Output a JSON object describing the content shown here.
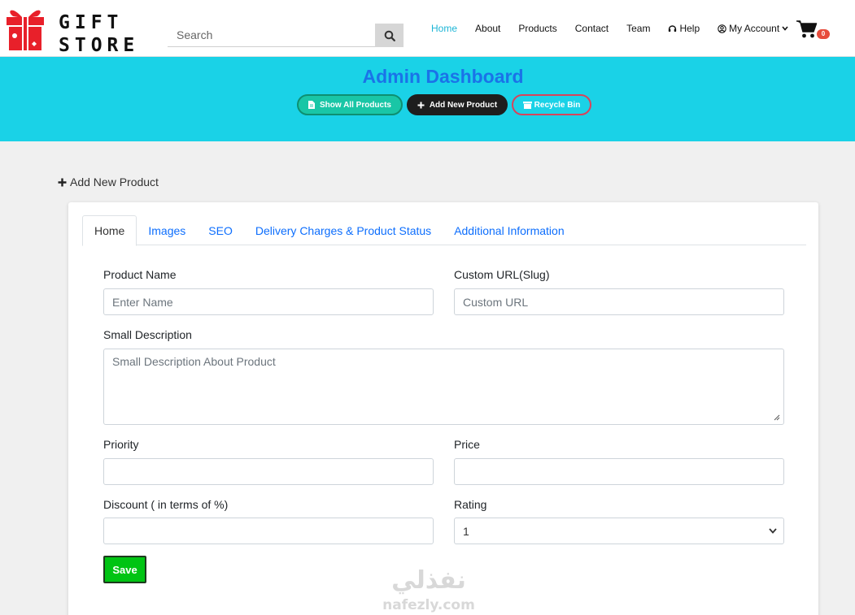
{
  "header": {
    "logo_line1": "GIFT",
    "logo_line2": "STORE",
    "search_placeholder": "Search",
    "nav": [
      {
        "label": "Home",
        "active": true
      },
      {
        "label": "About"
      },
      {
        "label": "Products"
      },
      {
        "label": "Contact"
      },
      {
        "label": "Team"
      },
      {
        "label": "Help",
        "icon": "headset-icon"
      },
      {
        "label": "My Account",
        "icon": "user-circle-icon",
        "chevron": "chevron-down-icon"
      }
    ],
    "cart_count": "0",
    "colors": {
      "accent": "#1cb5d6",
      "badge": "#e74c3c"
    }
  },
  "banner": {
    "title": "Admin Dashboard",
    "buttons": {
      "show_all": "Show All Products",
      "add_new": "Add New Product",
      "recycle_bin": "Recycle Bin"
    },
    "colors": {
      "background": "#1ad2e7",
      "title": "#1a73e8"
    }
  },
  "section": {
    "heading": "Add New Product"
  },
  "tabs": [
    {
      "label": "Home",
      "active": true
    },
    {
      "label": "Images"
    },
    {
      "label": "SEO"
    },
    {
      "label": "Delivery Charges & Product Status"
    },
    {
      "label": "Additional Information"
    }
  ],
  "form": {
    "product_name": {
      "label": "Product Name",
      "placeholder": "Enter Name",
      "value": ""
    },
    "slug": {
      "label": "Custom URL(Slug)",
      "placeholder": "Custom URL",
      "value": ""
    },
    "small_description": {
      "label": "Small Description",
      "placeholder": "Small Description About Product",
      "value": ""
    },
    "priority": {
      "label": "Priority",
      "value": ""
    },
    "price": {
      "label": "Price",
      "value": ""
    },
    "discount": {
      "label": "Discount ( in terms of %)",
      "value": ""
    },
    "rating": {
      "label": "Rating",
      "value": "1"
    },
    "save_label": "Save"
  },
  "watermark": {
    "arabic": "نفذلي",
    "latin": "nafezly.com"
  }
}
